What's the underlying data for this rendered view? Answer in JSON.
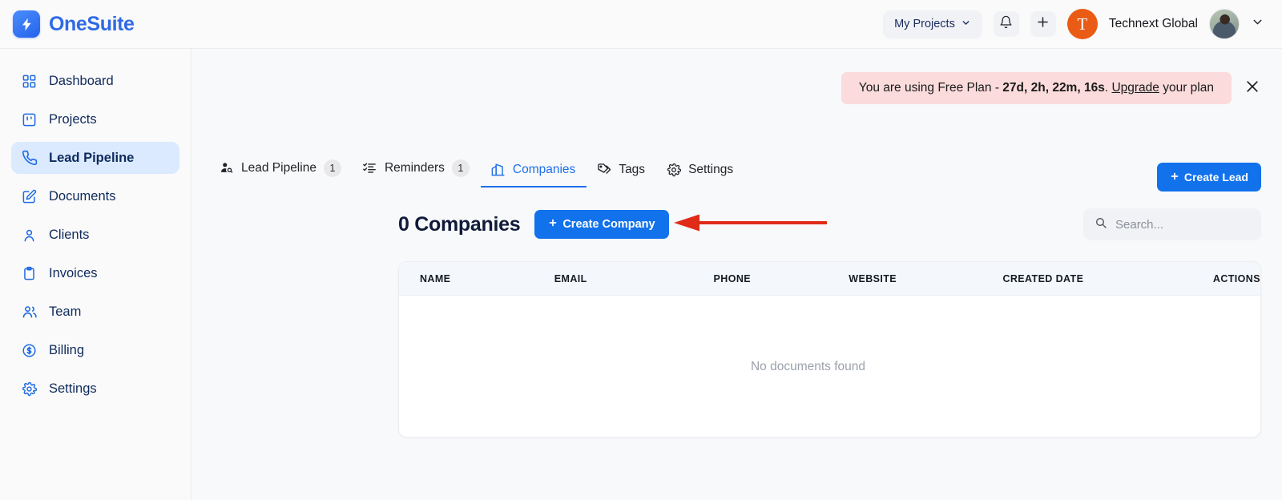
{
  "brand": {
    "name": "OneSuite",
    "logo_icon": "lightning-bolt-icon",
    "accent": "#2f6ae6"
  },
  "topbar": {
    "projects_selector": {
      "label": "My Projects",
      "chevron_icon": "chevron-down-icon"
    },
    "notifications_icon": "bell-icon",
    "add_icon": "plus-icon",
    "org": {
      "initial": "T",
      "name": "Technext Global",
      "avatar_color": "#ea5b16"
    },
    "user_menu_chevron_icon": "chevron-down-icon",
    "user_avatar_icon": "user-photo-avatar"
  },
  "sidebar": {
    "items": [
      {
        "label": "Dashboard",
        "icon": "grid-icon",
        "active": false
      },
      {
        "label": "Projects",
        "icon": "kanban-board-icon",
        "active": false
      },
      {
        "label": "Lead Pipeline",
        "icon": "phone-icon",
        "active": true
      },
      {
        "label": "Documents",
        "icon": "edit-document-icon",
        "active": false
      },
      {
        "label": "Clients",
        "icon": "user-icon",
        "active": false
      },
      {
        "label": "Invoices",
        "icon": "clipboard-icon",
        "active": false
      },
      {
        "label": "Team",
        "icon": "users-icon",
        "active": false
      },
      {
        "label": "Billing",
        "icon": "dollar-circle-icon",
        "active": false
      },
      {
        "label": "Settings",
        "icon": "gear-icon",
        "active": false
      }
    ]
  },
  "banner": {
    "text_prefix": "You are using Free Plan - ",
    "countdown": "27d, 2h, 22m, 16s",
    "text_middle": ". ",
    "upgrade_link": "Upgrade",
    "text_suffix": " your plan",
    "background": "#fbdbdb",
    "close_icon": "close-icon"
  },
  "tabs": [
    {
      "label": "Lead Pipeline",
      "icon": "user-search-icon",
      "badge": "1",
      "active": false
    },
    {
      "label": "Reminders",
      "icon": "checklist-icon",
      "badge": "1",
      "active": false
    },
    {
      "label": "Companies",
      "icon": "building-icon",
      "badge": "",
      "active": true
    },
    {
      "label": "Tags",
      "icon": "tag-icon",
      "badge": "",
      "active": false
    },
    {
      "label": "Settings",
      "icon": "gear-icon",
      "badge": "",
      "active": false
    }
  ],
  "actions": {
    "create_lead_label": "Create Lead",
    "create_company_label": "Create Company",
    "plus_icon": "plus-icon",
    "primary_color": "#1272ec"
  },
  "page": {
    "count": "0",
    "entity_label": "Companies"
  },
  "search": {
    "placeholder": "Search...",
    "value": "",
    "icon": "search-icon"
  },
  "table": {
    "columns": [
      "NAME",
      "EMAIL",
      "PHONE",
      "WEBSITE",
      "CREATED DATE",
      "ACTIONS"
    ],
    "rows": [],
    "empty_message": "No documents found"
  },
  "annotation": {
    "type": "arrow-left",
    "color": "#e02b19"
  }
}
